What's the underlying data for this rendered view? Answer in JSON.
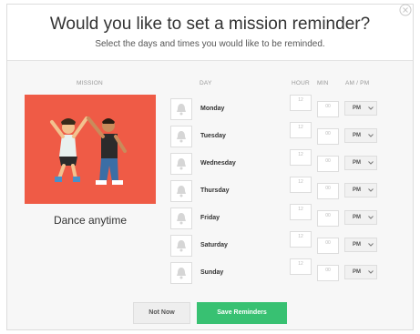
{
  "dialog": {
    "title": "Would you like to set a mission reminder?",
    "subtitle": "Select the days and times you would like to be reminded."
  },
  "columns": {
    "mission": "MISSION",
    "day": "DAY",
    "hour": "HOUR",
    "min": "MIN",
    "ampm": "AM / PM"
  },
  "mission": {
    "name": "Dance anytime",
    "card_color": "#ef5b46"
  },
  "days": [
    {
      "label": "Monday",
      "hour": "12",
      "minute": "00",
      "period": "PM"
    },
    {
      "label": "Tuesday",
      "hour": "12",
      "minute": "00",
      "period": "PM"
    },
    {
      "label": "Wednesday",
      "hour": "12",
      "minute": "00",
      "period": "PM"
    },
    {
      "label": "Thursday",
      "hour": "12",
      "minute": "00",
      "period": "PM"
    },
    {
      "label": "Friday",
      "hour": "12",
      "minute": "00",
      "period": "PM"
    },
    {
      "label": "Saturday",
      "hour": "12",
      "minute": "00",
      "period": "PM"
    },
    {
      "label": "Sunday",
      "hour": "12",
      "minute": "00",
      "period": "PM"
    }
  ],
  "actions": {
    "not_now": "Not Now",
    "save": "Save Reminders"
  },
  "icons": {
    "close": "close-icon",
    "bell": "bell-icon",
    "chevron": "chevron-down-icon"
  },
  "colors": {
    "save_button": "#38c172",
    "mission_card": "#ef5b46"
  }
}
